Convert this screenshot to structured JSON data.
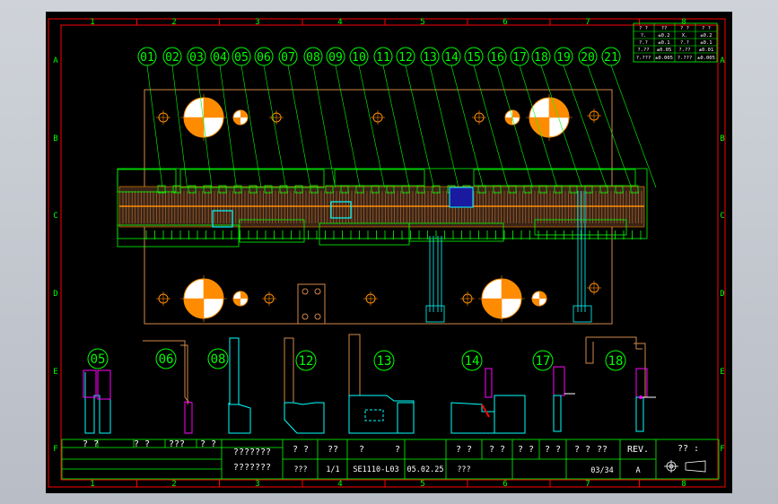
{
  "drawing": {
    "border_columns": [
      "1",
      "2",
      "3",
      "4",
      "5",
      "6",
      "7",
      "8"
    ],
    "border_rows": [
      "A",
      "B",
      "C",
      "D",
      "E",
      "F"
    ],
    "station_numbers": [
      "01",
      "02",
      "03",
      "04",
      "05",
      "06",
      "07",
      "08",
      "09",
      "10",
      "11",
      "12",
      "13",
      "14",
      "15",
      "16",
      "17",
      "18",
      "19",
      "20",
      "21"
    ],
    "section_labels": [
      "05",
      "06",
      "08",
      "12",
      "13",
      "14",
      "17",
      "18"
    ],
    "tolerance_table": [
      [
        "? ?",
        "??",
        "? ?",
        "? ?"
      ],
      [
        "?.",
        "±0.2",
        "X.",
        "±0.2"
      ],
      [
        "?.?",
        "±0.1",
        "?.?",
        "±0.1"
      ],
      [
        "?.??",
        "±0.05",
        "?.??",
        "±0.01"
      ],
      [
        "?.???",
        "±0.005",
        "?.???",
        "±0.005"
      ]
    ],
    "colors": {
      "outline": "#00ff00",
      "sheet_border": "#ff0000",
      "part": "#ff8c00",
      "steel": "#00ffff",
      "punch": "#ff00ff",
      "plate": "#c87a3c",
      "text": "#ffffff"
    }
  },
  "title_block": {
    "revision_header": [
      "? ?",
      "? ?",
      "???",
      "? ?"
    ],
    "note_1": "???????",
    "note_2": "???????",
    "field_headers": [
      "? ?",
      "??",
      "?",
      "?",
      "? ?",
      "? ?",
      "? ?",
      "? ?",
      "? ?",
      "??"
    ],
    "values": [
      "???",
      "1/1",
      "SE1110-L03",
      "05.02.25",
      "???"
    ],
    "sheet_no": "03/34",
    "rev_label": "REV.",
    "rev_value": "A",
    "corner_label": "?? :"
  }
}
